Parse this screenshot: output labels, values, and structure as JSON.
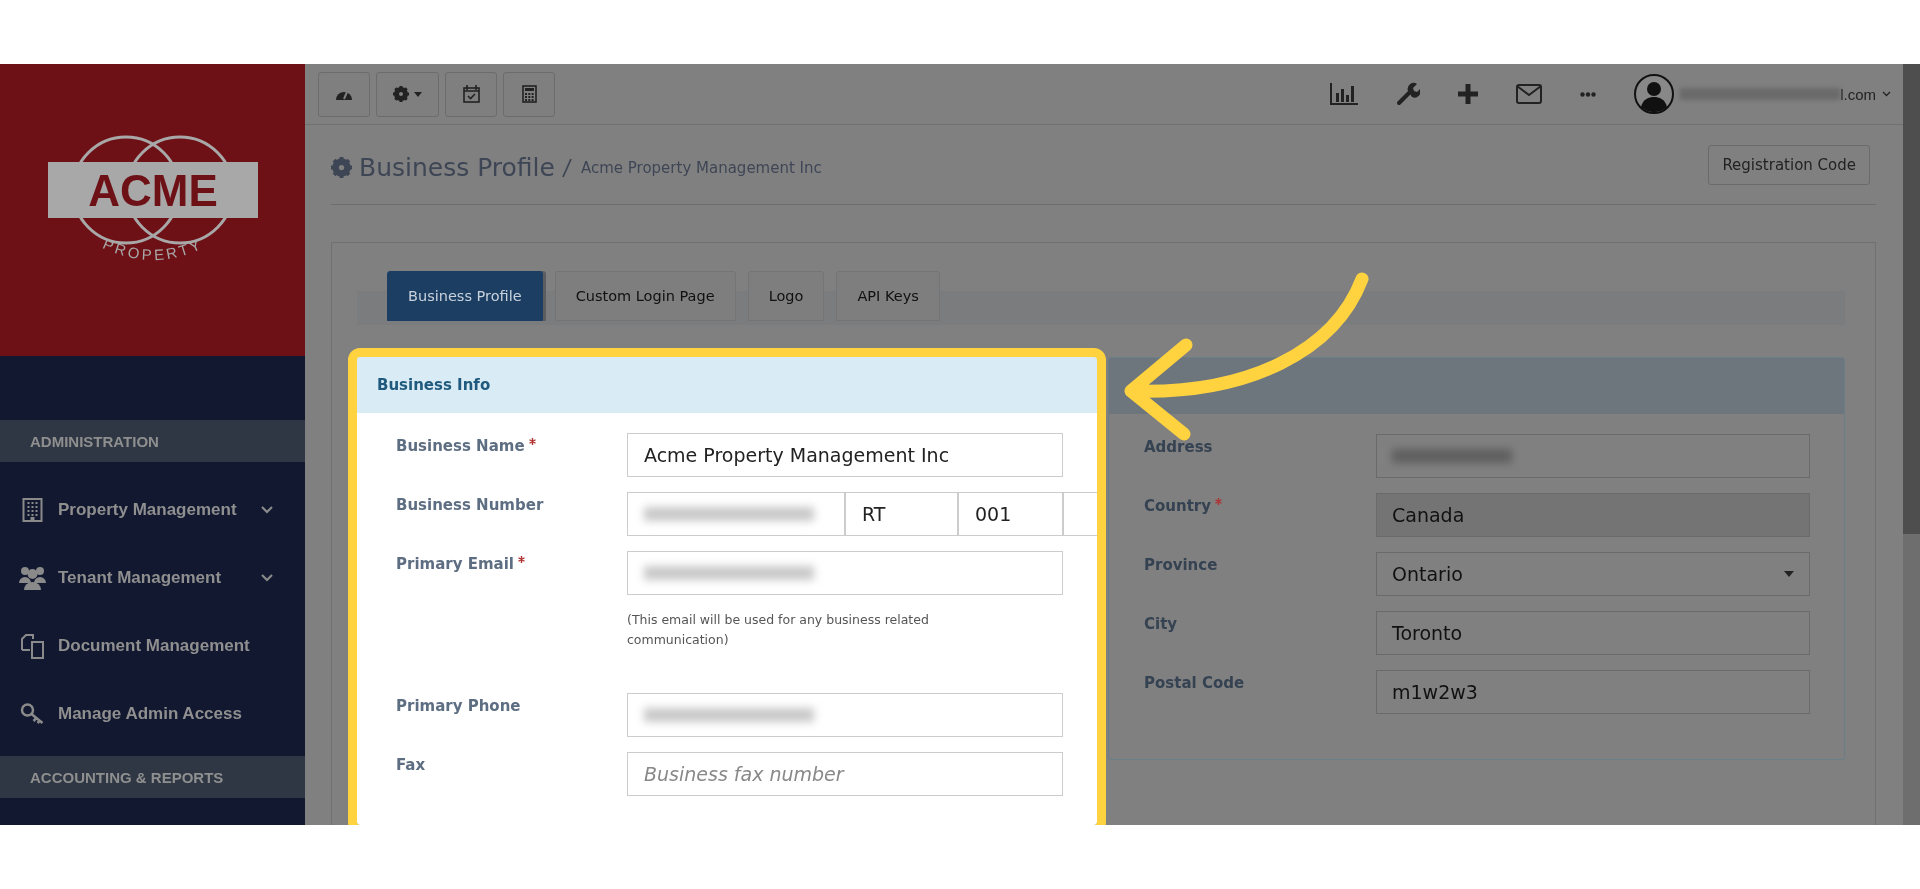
{
  "logo": {
    "name": "ACME",
    "tagline": "PROPERTY"
  },
  "sidebar": {
    "sections": [
      {
        "title": "ADMINISTRATION",
        "items": [
          {
            "label": "Property Management",
            "expandable": true
          },
          {
            "label": "Tenant Management",
            "expandable": true
          },
          {
            "label": "Document Management",
            "expandable": false
          },
          {
            "label": "Manage Admin Access",
            "expandable": false
          }
        ]
      },
      {
        "title": "ACCOUNTING & REPORTS"
      }
    ]
  },
  "user": {
    "email_visible": "l.com"
  },
  "page_header": {
    "title": "Business Profile",
    "subtitle": "Acme Property Management Inc",
    "action": "Registration Code"
  },
  "tabs": [
    {
      "label": "Business Profile",
      "selected": true
    },
    {
      "label": "Custom Login Page",
      "selected": false
    },
    {
      "label": "Logo",
      "selected": false
    },
    {
      "label": "API Keys",
      "selected": false
    }
  ],
  "business_info": {
    "title": "Business Info",
    "highlighted": true,
    "fields": [
      {
        "kind": "text",
        "label": "Business Name",
        "required": true,
        "value": "Acme Property Management Inc"
      },
      {
        "kind": "split",
        "label": "Business Number",
        "required": false,
        "parts": [
          {
            "redacted": true
          },
          {
            "redacted": false,
            "value": "RT"
          },
          {
            "redacted": false,
            "value": "001"
          },
          {
            "redacted": false
          }
        ]
      },
      {
        "kind": "text",
        "label": "Primary Email",
        "required": true,
        "redacted": true,
        "help": "(This email will be used for any business related communication)"
      },
      {
        "kind": "text",
        "label": "Primary Phone",
        "required": false,
        "redacted": true
      },
      {
        "kind": "text",
        "label": "Fax",
        "required": false,
        "placeholder": "Business fax number"
      }
    ]
  },
  "address_info": {
    "fields": [
      {
        "kind": "text",
        "label": "Address",
        "required": false,
        "redacted": true
      },
      {
        "kind": "text",
        "label": "Country",
        "required": true,
        "value": "Canada",
        "disabled": true
      },
      {
        "kind": "select",
        "label": "Province",
        "required": false,
        "value": "Ontario"
      },
      {
        "kind": "text",
        "label": "City",
        "required": false,
        "value": "Toronto"
      },
      {
        "kind": "text",
        "label": "Postal Code",
        "required": false,
        "value": "m1w2w3"
      }
    ]
  }
}
